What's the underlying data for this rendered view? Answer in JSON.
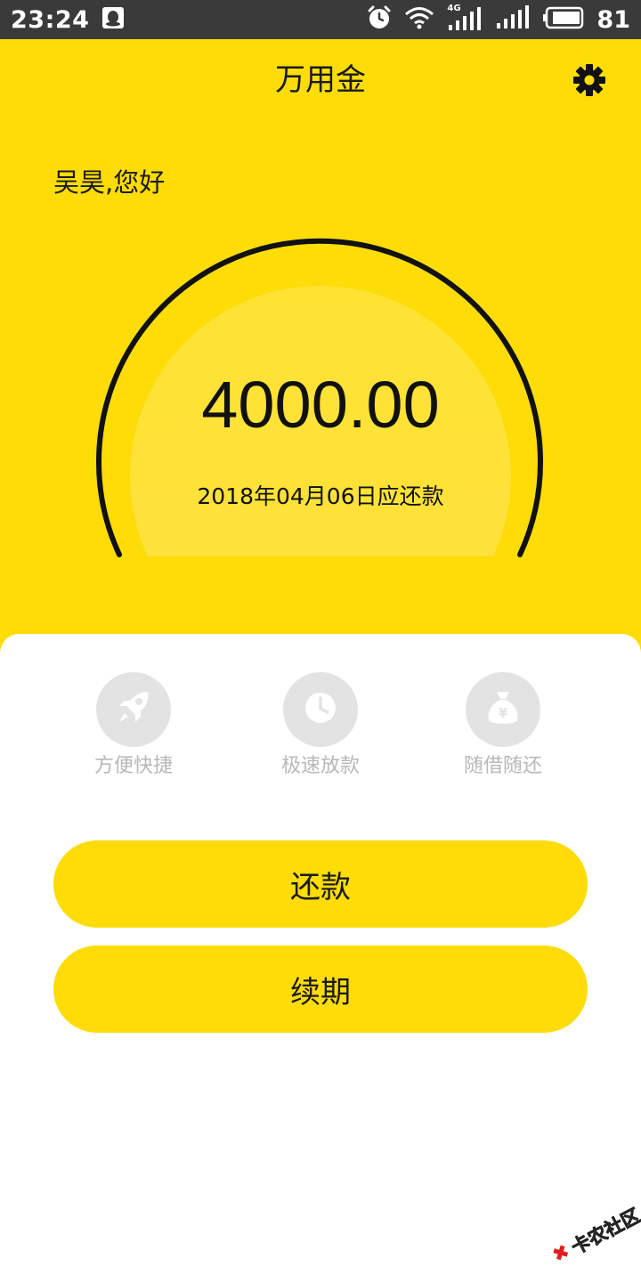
{
  "status_bar": {
    "time": "23:24",
    "network_label": "4G",
    "battery_level": "81",
    "icons": [
      "qq-icon",
      "alarm-icon",
      "wifi-icon",
      "signal-icon",
      "signal-icon",
      "battery-icon"
    ]
  },
  "header": {
    "title": "万用金",
    "settings_icon": "gear-icon"
  },
  "greeting": "吴昊,您好",
  "loan": {
    "amount": "4000.00",
    "due_text": "2018年04月06日应还款"
  },
  "features": [
    {
      "icon": "rocket-icon",
      "label": "方便快捷"
    },
    {
      "icon": "clock-icon",
      "label": "极速放款"
    },
    {
      "icon": "money-bag-icon",
      "label": "随借随还"
    }
  ],
  "actions": {
    "repay_label": "还款",
    "renew_label": "续期"
  },
  "watermark": "卡农社区",
  "colors": {
    "accent": "#fddc07",
    "status_bar": "#3a3a3a",
    "feature_icon_bg": "#e3e3e3",
    "feature_label": "#b8b8b8",
    "text": "#1a1a1a"
  }
}
